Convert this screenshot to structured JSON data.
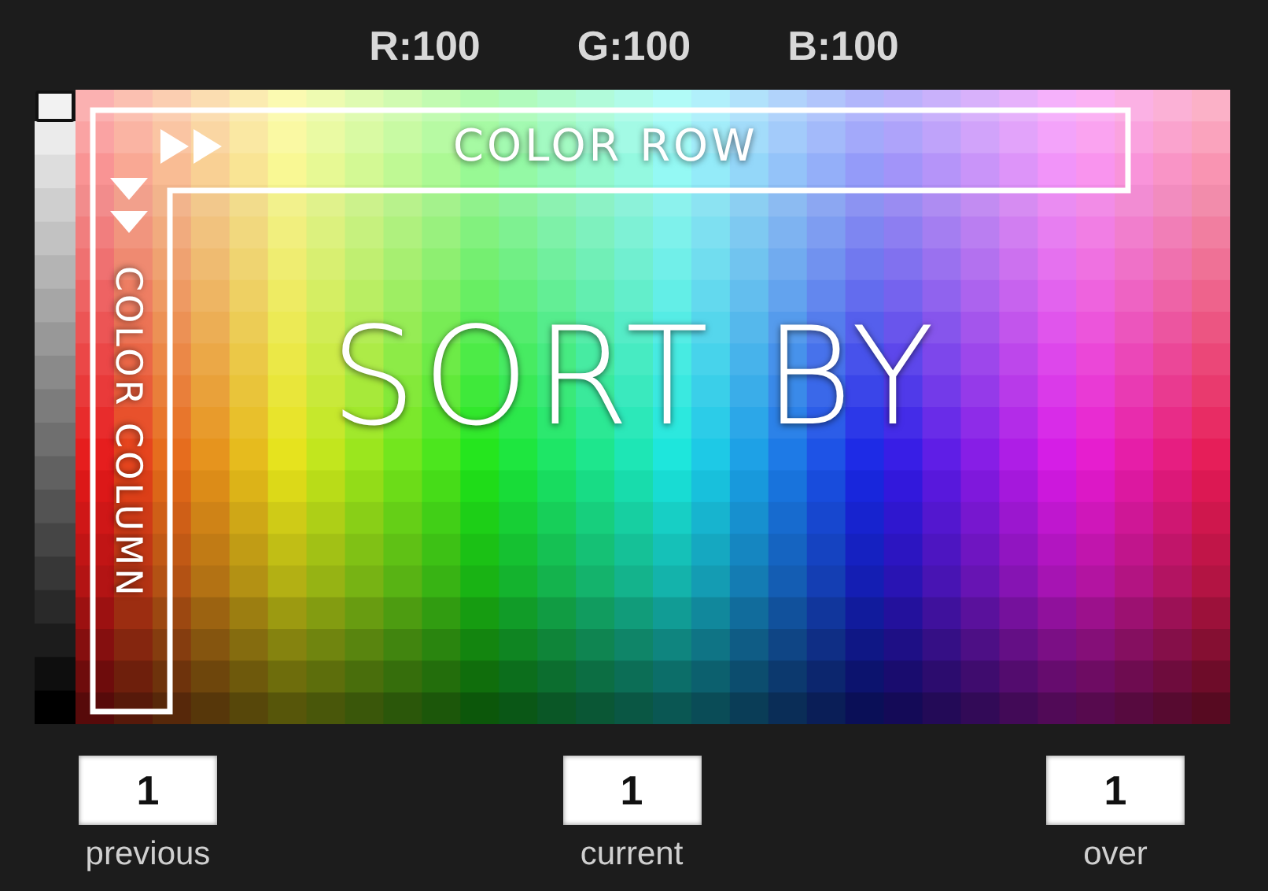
{
  "readouts": [
    "R:100",
    "G:100",
    "B:100"
  ],
  "overlay": {
    "row_label": "COLOR ROW",
    "column_label": "COLOR COLUMN",
    "title": "SORT BY"
  },
  "fields": [
    {
      "value": "1",
      "label": "previous"
    },
    {
      "value": "1",
      "label": "current"
    },
    {
      "value": "1",
      "label": "over"
    }
  ]
}
